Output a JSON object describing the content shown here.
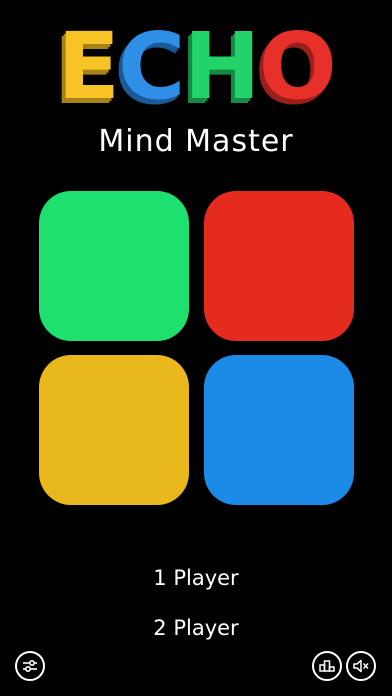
{
  "logo": {
    "letters": [
      {
        "char": "E",
        "color": "#F7C325",
        "shadow": "#A58213"
      },
      {
        "char": "C",
        "color": "#2F8FE6",
        "shadow": "#1A5A98"
      },
      {
        "char": "H",
        "color": "#22D36A",
        "shadow": "#168A45"
      },
      {
        "char": "O",
        "color": "#E8302A",
        "shadow": "#991F1B"
      }
    ]
  },
  "subtitle": "Mind Master",
  "pads": {
    "green": "#1EE06E",
    "red": "#E52A1E",
    "yellow": "#E8B81C",
    "blue": "#1C8BE8"
  },
  "menu": {
    "one_player": "1 Player",
    "two_player": "2 Player"
  },
  "icons": {
    "settings": "sliders-icon",
    "leaderboard": "podium-icon",
    "sound": "speaker-muted-icon"
  }
}
